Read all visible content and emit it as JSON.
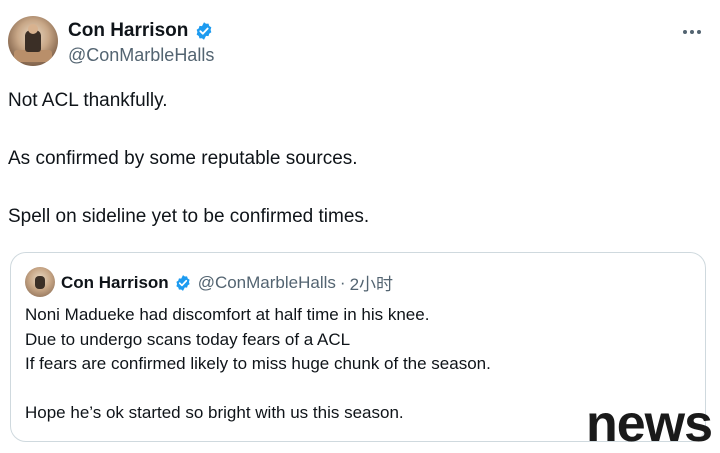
{
  "tweet": {
    "author": {
      "display_name": "Con Harrison",
      "handle": "@ConMarbleHalls",
      "verified": true,
      "avatar_icon": "marble-statue-avatar"
    },
    "more_icon": "more-horizontal-icon",
    "text": [
      "Not ACL thankfully.",
      "As confirmed by some reputable sources.",
      "Spell on sideline yet to be confirmed times."
    ]
  },
  "quoted_tweet": {
    "author": {
      "display_name": "Con Harrison",
      "handle": "@ConMarbleHalls",
      "verified": true
    },
    "separator": "·",
    "time": "2小时",
    "lines": [
      "Noni Madueke had discomfort at half time in his knee.",
      "Due to undergo scans today fears of a ACL",
      "If fears are confirmed likely to miss huge chunk of the season.",
      "Hope he’s ok started so bright with us this season."
    ]
  },
  "watermark": "news",
  "colors": {
    "verified_blue": "#1d9bf0",
    "secondary_text": "#536471",
    "border": "#cfd9de"
  }
}
